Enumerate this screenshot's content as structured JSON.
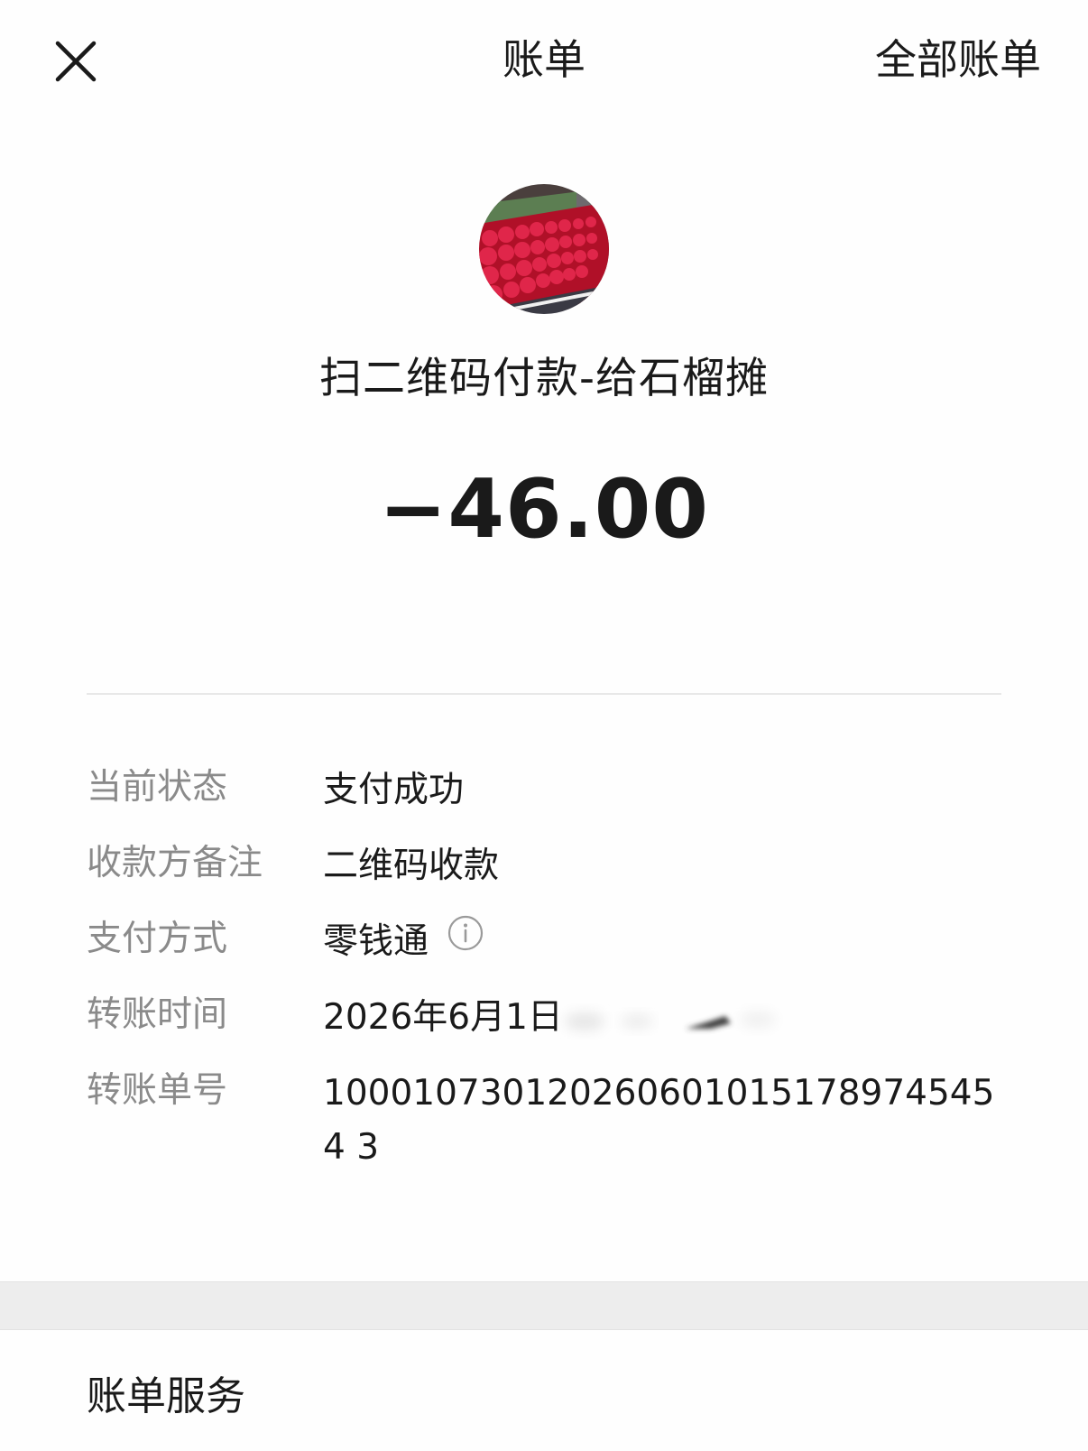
{
  "header": {
    "title": "账单",
    "all_bills_label": "全部账单",
    "close_icon": "close-icon"
  },
  "merchant": {
    "avatar": "pomegranate-stall-photo",
    "name": "扫二维码付款-给石榴摊"
  },
  "amount": "−46.00",
  "details": {
    "status": {
      "label": "当前状态",
      "value": "支付成功"
    },
    "payee_note": {
      "label": "收款方备注",
      "value": "二维码收款"
    },
    "payment_method": {
      "label": "支付方式",
      "value": "零钱通",
      "icon": "info-icon"
    },
    "transfer_time": {
      "label": "转账时间",
      "value": "2026年6月1日"
    },
    "transfer_id": {
      "label": "转账单号",
      "value": "1000107301202606010151789745454 3"
    }
  },
  "service": {
    "title": "账单服务"
  },
  "colors": {
    "background": "#fefefe",
    "label_gray": "#8a8a8a",
    "text": "#1a1a1a",
    "divider": "#e8e8e8",
    "band": "#ededed"
  }
}
